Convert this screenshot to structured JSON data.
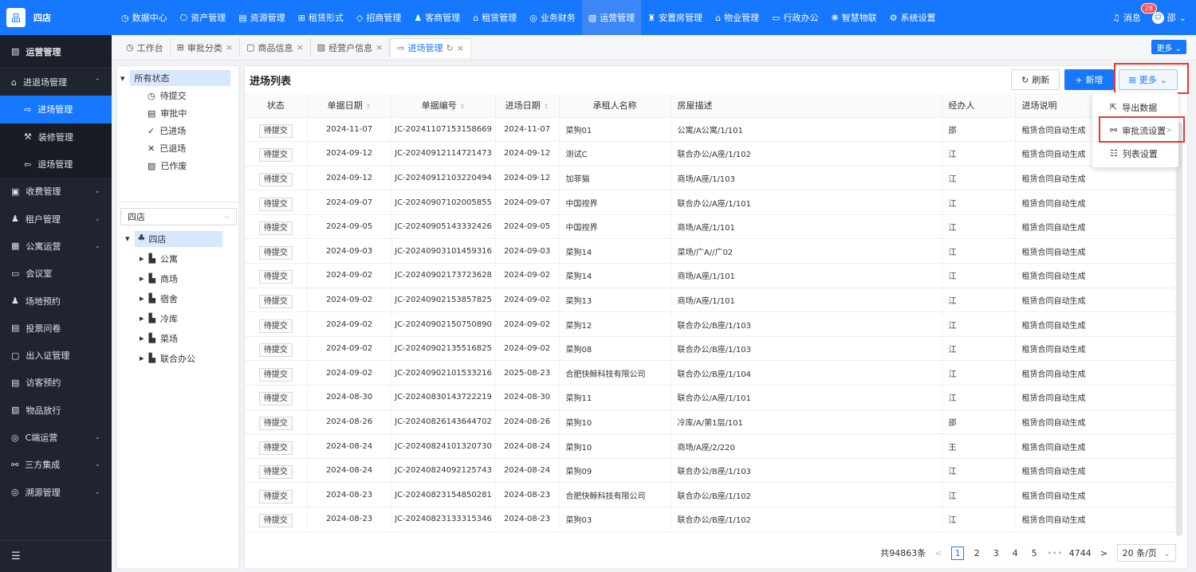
{
  "brand": {
    "logo": "品",
    "name": "四店"
  },
  "topnav": [
    {
      "icon": "◷",
      "label": "数据中心"
    },
    {
      "icon": "⎔",
      "label": "资产管理"
    },
    {
      "icon": "▤",
      "label": "资源管理"
    },
    {
      "icon": "⊞",
      "label": "租赁形式"
    },
    {
      "icon": "◇",
      "label": "招商管理"
    },
    {
      "icon": "♟",
      "label": "客商管理"
    },
    {
      "icon": "⌂",
      "label": "租赁管理"
    },
    {
      "icon": "◎",
      "label": "业务财务"
    },
    {
      "icon": "▧",
      "label": "运营管理"
    },
    {
      "icon": "♜",
      "label": "安置房管理"
    },
    {
      "icon": "⌂",
      "label": "物业管理"
    },
    {
      "icon": "▭",
      "label": "行政办公"
    },
    {
      "icon": "❋",
      "label": "智慧物联"
    },
    {
      "icon": "⚙",
      "label": "系统设置"
    }
  ],
  "topright": {
    "messages_label": "消息",
    "messages_count": "28",
    "user_name": "邵",
    "user_avatar": "☺"
  },
  "sidebar": {
    "title": "运营管理",
    "items": [
      {
        "label": "进退场管理",
        "icon": "⌂",
        "chev": "⌃",
        "type": "parent"
      },
      {
        "label": "进场管理",
        "icon": "⇨",
        "type": "sub",
        "active": true
      },
      {
        "label": "装修管理",
        "icon": "⚒",
        "type": "sub"
      },
      {
        "label": "退场管理",
        "icon": "⇦",
        "type": "sub"
      },
      {
        "label": "收费管理",
        "icon": "▣",
        "chev": "⌄"
      },
      {
        "label": "租户管理",
        "icon": "♟",
        "chev": "⌄"
      },
      {
        "label": "公寓运营",
        "icon": "▦",
        "chev": "⌄"
      },
      {
        "label": "会议室",
        "icon": "▭"
      },
      {
        "label": "场地预约",
        "icon": "♟"
      },
      {
        "label": "投票问卷",
        "icon": "▤"
      },
      {
        "label": "出入证管理",
        "icon": "▢"
      },
      {
        "label": "访客预约",
        "icon": "▤"
      },
      {
        "label": "物品放行",
        "icon": "▧"
      },
      {
        "label": "C端运营",
        "icon": "◎",
        "chev": "⌄"
      },
      {
        "label": "三方集成",
        "icon": "⚯",
        "chev": "⌄"
      },
      {
        "label": "溯源管理",
        "icon": "◎",
        "chev": "⌄"
      }
    ],
    "footer_icon": "☰"
  },
  "tabs": [
    {
      "icon": "◷",
      "label": "工作台"
    },
    {
      "icon": "⊞",
      "label": "审批分类",
      "close": "×"
    },
    {
      "icon": "▢",
      "label": "商品信息",
      "close": "×"
    },
    {
      "icon": "▨",
      "label": "经营户信息",
      "close": "×"
    },
    {
      "icon": "⇨",
      "label": "进场管理",
      "close": "×",
      "refresh": "↻",
      "active": true
    }
  ],
  "tabs_more": "更多 ⌄",
  "status_tree": {
    "root": "所有状态",
    "root_toggle": "▾",
    "items": [
      {
        "icon": "◷",
        "label": "待提交"
      },
      {
        "icon": "▤",
        "label": "审批中"
      },
      {
        "icon": "✓",
        "label": "已进场"
      },
      {
        "icon": "✕",
        "label": "已退场"
      },
      {
        "icon": "▨",
        "label": "已作废"
      }
    ]
  },
  "store_select": {
    "value": "四店",
    "arrow": "⌵"
  },
  "store_tree": {
    "root": "四店",
    "root_toggle": "▾",
    "root_icon": "♣",
    "children": [
      {
        "label": "公寓"
      },
      {
        "label": "商场"
      },
      {
        "label": "宿舍"
      },
      {
        "label": "冷库"
      },
      {
        "label": "菜场"
      },
      {
        "label": "联合办公"
      }
    ],
    "child_toggle": "▸",
    "child_icon": "▙"
  },
  "main": {
    "title": "进场列表",
    "refresh": "刷新",
    "add": "新增",
    "more": "更多",
    "refresh_icon": "↻",
    "add_icon": "+",
    "more_icon": "⊞",
    "more_chev": "⌄"
  },
  "columns": [
    "状态",
    "单据日期",
    "单据编号",
    "进场日期",
    "承租人名称",
    "房屋描述",
    "经办人",
    "进场说明"
  ],
  "rows": [
    {
      "status": "待提交",
      "doc_date": "2024-11-07",
      "doc_no": "JC-20241107153158669",
      "entry_date": "2024-11-07",
      "tenant": "菜狗01",
      "room": "公寓/A公寓/1/101",
      "handler": "邵",
      "note": "租赁合同自动生成"
    },
    {
      "status": "待提交",
      "doc_date": "2024-09-12",
      "doc_no": "JC-20240912114721473",
      "entry_date": "2024-09-12",
      "tenant": "测试C",
      "room": "联合办公/A座/1/102",
      "handler": "江",
      "note": "租赁合同自动生成"
    },
    {
      "status": "待提交",
      "doc_date": "2024-09-12",
      "doc_no": "JC-20240912103220494",
      "entry_date": "2024-09-12",
      "tenant": "加菲猫",
      "room": "商场/A座/1/103",
      "handler": "江",
      "note": "租赁合同自动生成"
    },
    {
      "status": "待提交",
      "doc_date": "2024-09-07",
      "doc_no": "JC-20240907102005855",
      "entry_date": "2024-09-07",
      "tenant": "中国视界",
      "room": "联合办公/A座/1/101",
      "handler": "江",
      "note": "租赁合同自动生成"
    },
    {
      "status": "待提交",
      "doc_date": "2024-09-05",
      "doc_no": "JC-20240905143332426",
      "entry_date": "2024-09-05",
      "tenant": "中国视界",
      "room": "商场/A座/1/101",
      "handler": "江",
      "note": "租赁合同自动生成"
    },
    {
      "status": "待提交",
      "doc_date": "2024-09-03",
      "doc_no": "JC-20240903101459316",
      "entry_date": "2024-09-03",
      "tenant": "菜狗14",
      "room": "菜场/广A//广02",
      "handler": "江",
      "note": "租赁合同自动生成"
    },
    {
      "status": "待提交",
      "doc_date": "2024-09-02",
      "doc_no": "JC-20240902173723628",
      "entry_date": "2024-09-02",
      "tenant": "菜狗14",
      "room": "商场/A座/1/101",
      "handler": "江",
      "note": "租赁合同自动生成"
    },
    {
      "status": "待提交",
      "doc_date": "2024-09-02",
      "doc_no": "JC-20240902153857825",
      "entry_date": "2024-09-02",
      "tenant": "菜狗13",
      "room": "商场/A座/1/101",
      "handler": "江",
      "note": "租赁合同自动生成"
    },
    {
      "status": "待提交",
      "doc_date": "2024-09-02",
      "doc_no": "JC-20240902150750890",
      "entry_date": "2024-09-02",
      "tenant": "菜狗12",
      "room": "联合办公/B座/1/103",
      "handler": "江",
      "note": "租赁合同自动生成"
    },
    {
      "status": "待提交",
      "doc_date": "2024-09-02",
      "doc_no": "JC-20240902135516825",
      "entry_date": "2024-09-02",
      "tenant": "菜狗08",
      "room": "联合办公/B座/1/103",
      "handler": "江",
      "note": "租赁合同自动生成"
    },
    {
      "status": "待提交",
      "doc_date": "2024-09-02",
      "doc_no": "JC-20240902101533216",
      "entry_date": "2025-08-23",
      "tenant": "合肥快鲸科技有限公司",
      "room": "联合办公/B座/1/104",
      "handler": "江",
      "note": "租赁合同自动生成"
    },
    {
      "status": "待提交",
      "doc_date": "2024-08-30",
      "doc_no": "JC-20240830143722219",
      "entry_date": "2024-08-30",
      "tenant": "菜狗11",
      "room": "联合办公/A座/1/101",
      "handler": "江",
      "note": "租赁合同自动生成"
    },
    {
      "status": "待提交",
      "doc_date": "2024-08-26",
      "doc_no": "JC-20240826143644702",
      "entry_date": "2024-08-26",
      "tenant": "菜狗10",
      "room": "冷库/A/第1层/101",
      "handler": "邵",
      "note": "租赁合同自动生成"
    },
    {
      "status": "待提交",
      "doc_date": "2024-08-24",
      "doc_no": "JC-20240824101320730",
      "entry_date": "2024-08-24",
      "tenant": "菜狗10",
      "room": "商场/A座/2/220",
      "handler": "王",
      "note": "租赁合同自动生成"
    },
    {
      "status": "待提交",
      "doc_date": "2024-08-24",
      "doc_no": "JC-20240824092125743",
      "entry_date": "2024-08-24",
      "tenant": "菜狗09",
      "room": "联合办公/B座/1/103",
      "handler": "江",
      "note": "租赁合同自动生成"
    },
    {
      "status": "待提交",
      "doc_date": "2024-08-23",
      "doc_no": "JC-20240823154850281",
      "entry_date": "2024-08-23",
      "tenant": "合肥快鲸科技有限公司",
      "room": "联合办公/B座/1/102",
      "handler": "江",
      "note": "租赁合同自动生成"
    },
    {
      "status": "待提交",
      "doc_date": "2024-08-23",
      "doc_no": "JC-20240823133315346",
      "entry_date": "2024-08-23",
      "tenant": "菜狗03",
      "room": "联合办公/B座/1/102",
      "handler": "江",
      "note": "租赁合同自动生成"
    }
  ],
  "sort_glyph": "⇕",
  "pagination": {
    "total": "共94863条",
    "prev": "<",
    "pages": [
      "1",
      "2",
      "3",
      "4",
      "5"
    ],
    "ellipsis": "•••",
    "last": "4744",
    "next": ">",
    "size": "20 条/页",
    "size_arrow": "⌄"
  },
  "dropdown": {
    "items": [
      {
        "icon": "⇱",
        "label": "导出数据"
      },
      {
        "icon": "⚯",
        "label": "审批流设置",
        "chev": ">"
      },
      {
        "icon": "☷",
        "label": "列表设置"
      }
    ]
  },
  "colors": {
    "primary": "#1677ff",
    "sidebar": "#1f2430",
    "highlight_box": "#e53935"
  }
}
